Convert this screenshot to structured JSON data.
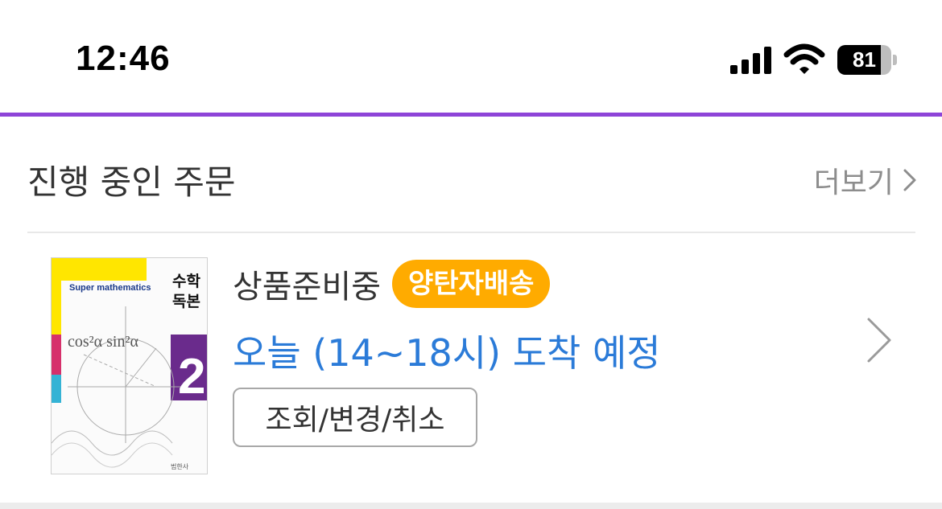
{
  "status_bar": {
    "time": "12:46",
    "battery_level": 81,
    "battery_label": "81",
    "signal_icon": "cellular-signal-icon",
    "wifi_icon": "wifi-icon"
  },
  "colors": {
    "accent_line": "#8e44d8",
    "badge": "#ffab00",
    "arrival_text": "#2b7bd8"
  },
  "section": {
    "title": "진행 중인 주문",
    "more_label": "더보기"
  },
  "order": {
    "status": "상품준비중",
    "delivery_badge": "양탄자배송",
    "arrival": "오늘 (14~18시) 도착 예정",
    "action_button": "조회/변경/취소",
    "product_cover": {
      "subtitle": "Super mathematics",
      "title_line1": "수학",
      "title_line2": "독본",
      "volume": "2",
      "formula": "cos²α sin²α",
      "publisher": "범한사"
    }
  }
}
